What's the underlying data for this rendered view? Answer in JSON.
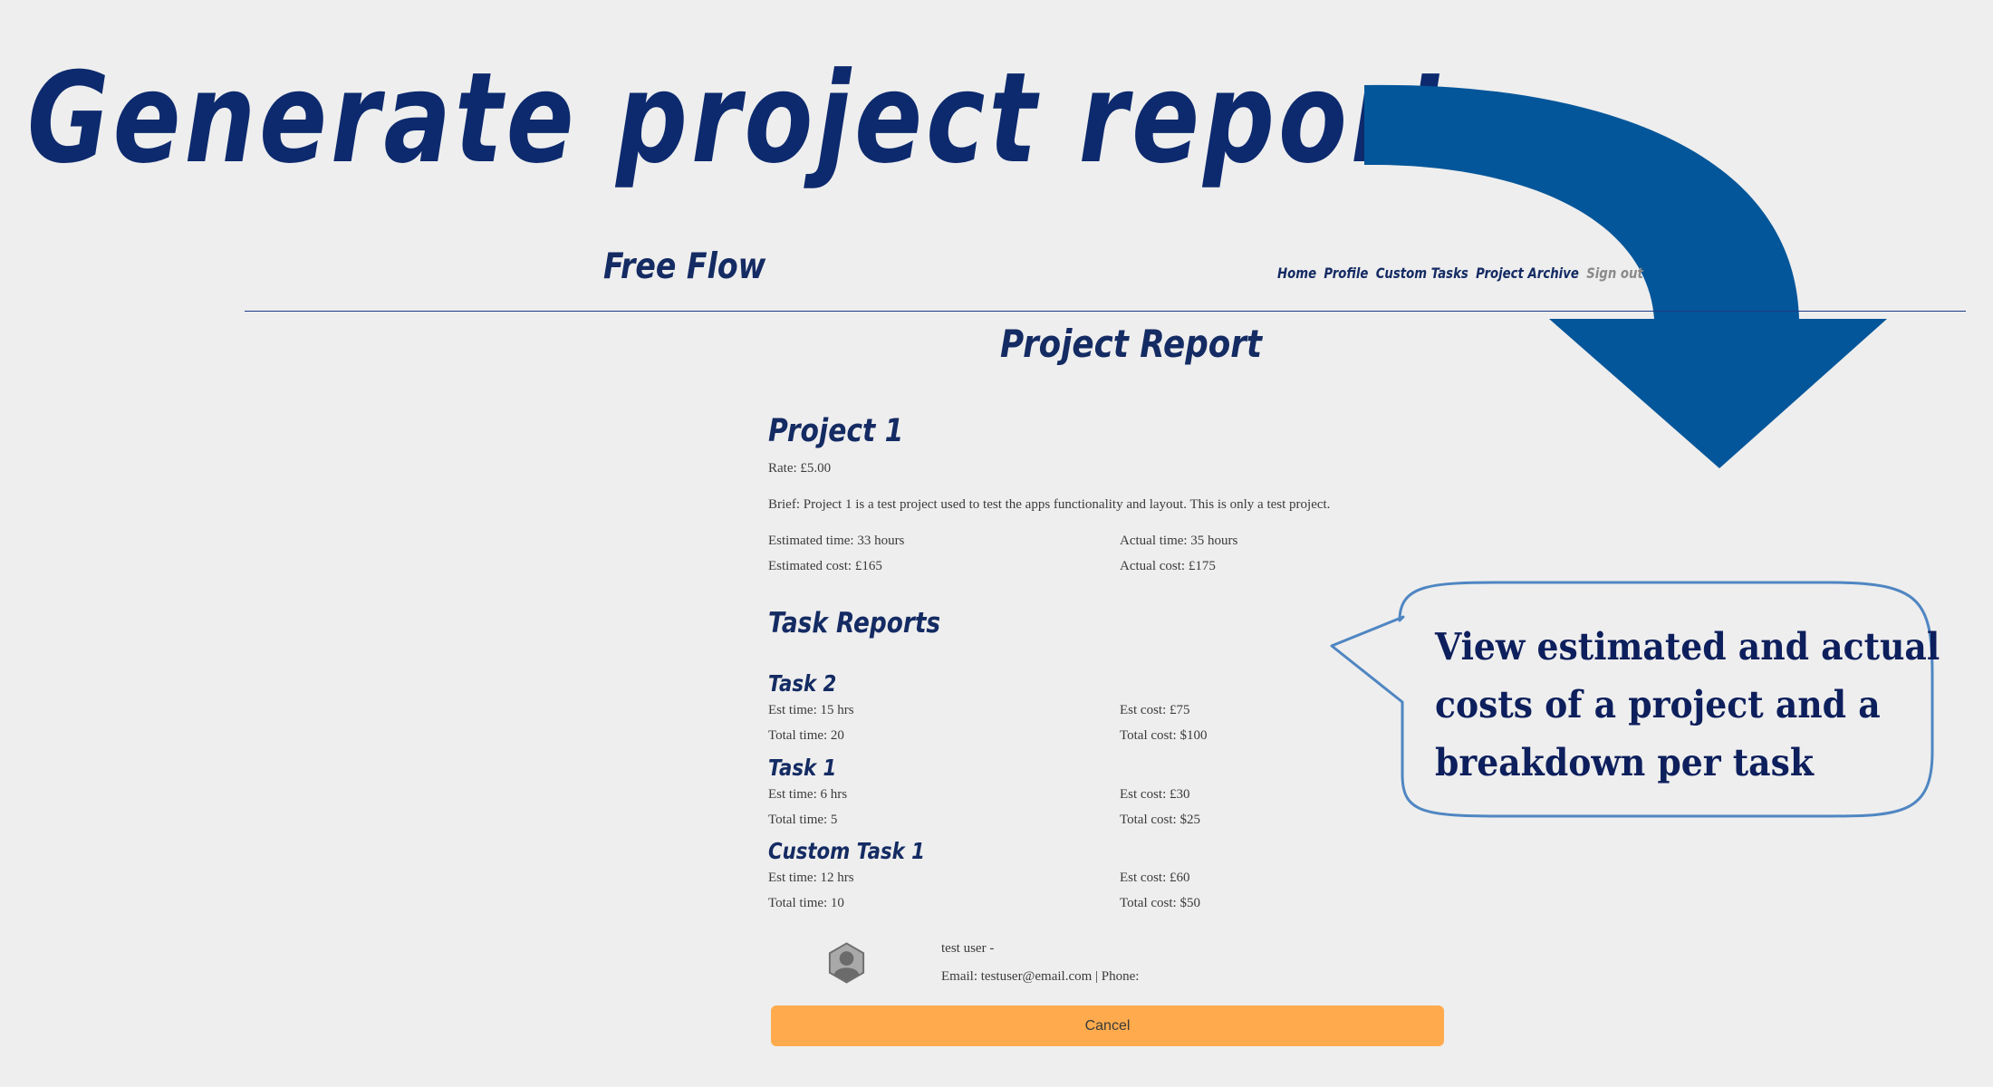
{
  "headline": "Generate project reports",
  "app": {
    "brand": "Free Flow",
    "nav": [
      "Home",
      "Profile",
      "Custom Tasks",
      "Project Archive",
      "Sign out"
    ]
  },
  "page_title": "Project Report",
  "project": {
    "name": "Project 1",
    "rate": "Rate: £5.00",
    "brief": "Brief: Project 1 is a test project used to test the apps functionality and layout. This is only a test project.",
    "estimated_time": "Estimated time: 33 hours",
    "actual_time": "Actual time: 35 hours",
    "estimated_cost": "Estimated cost: £165",
    "actual_cost": "Actual cost: £175"
  },
  "task_reports_title": "Task Reports",
  "tasks": [
    {
      "name": "Task 2",
      "est_time": "Est time: 15 hrs",
      "est_cost": "Est cost: £75",
      "total_time": "Total time: 20",
      "total_cost": "Total cost: $100"
    },
    {
      "name": "Task 1",
      "est_time": "Est time: 6 hrs",
      "est_cost": "Est cost: £30",
      "total_time": "Total time: 5",
      "total_cost": "Total cost: $25"
    },
    {
      "name": "Custom Task 1",
      "est_time": "Est time: 12 hrs",
      "est_cost": "Est cost: £60",
      "total_time": "Total time: 10",
      "total_cost": "Total cost: $50"
    }
  ],
  "user": {
    "name": "test user -",
    "contact": "Email: testuser@email.com | Phone:"
  },
  "cancel_label": "Cancel",
  "callout": {
    "line1": "View estimated and actual",
    "line2": "costs of a project and a",
    "line3": "breakdown per task"
  },
  "colors": {
    "headline": "#0d2a6e",
    "brand_navy": "#142b63",
    "arrow": "#04569a",
    "cancel_button": "#ffab4d",
    "bubble_border": "#4f86c2",
    "background": "#eeeeee"
  },
  "icons": {
    "arrow": "curved-down-arrow",
    "avatar": "user-avatar-hexagon"
  }
}
